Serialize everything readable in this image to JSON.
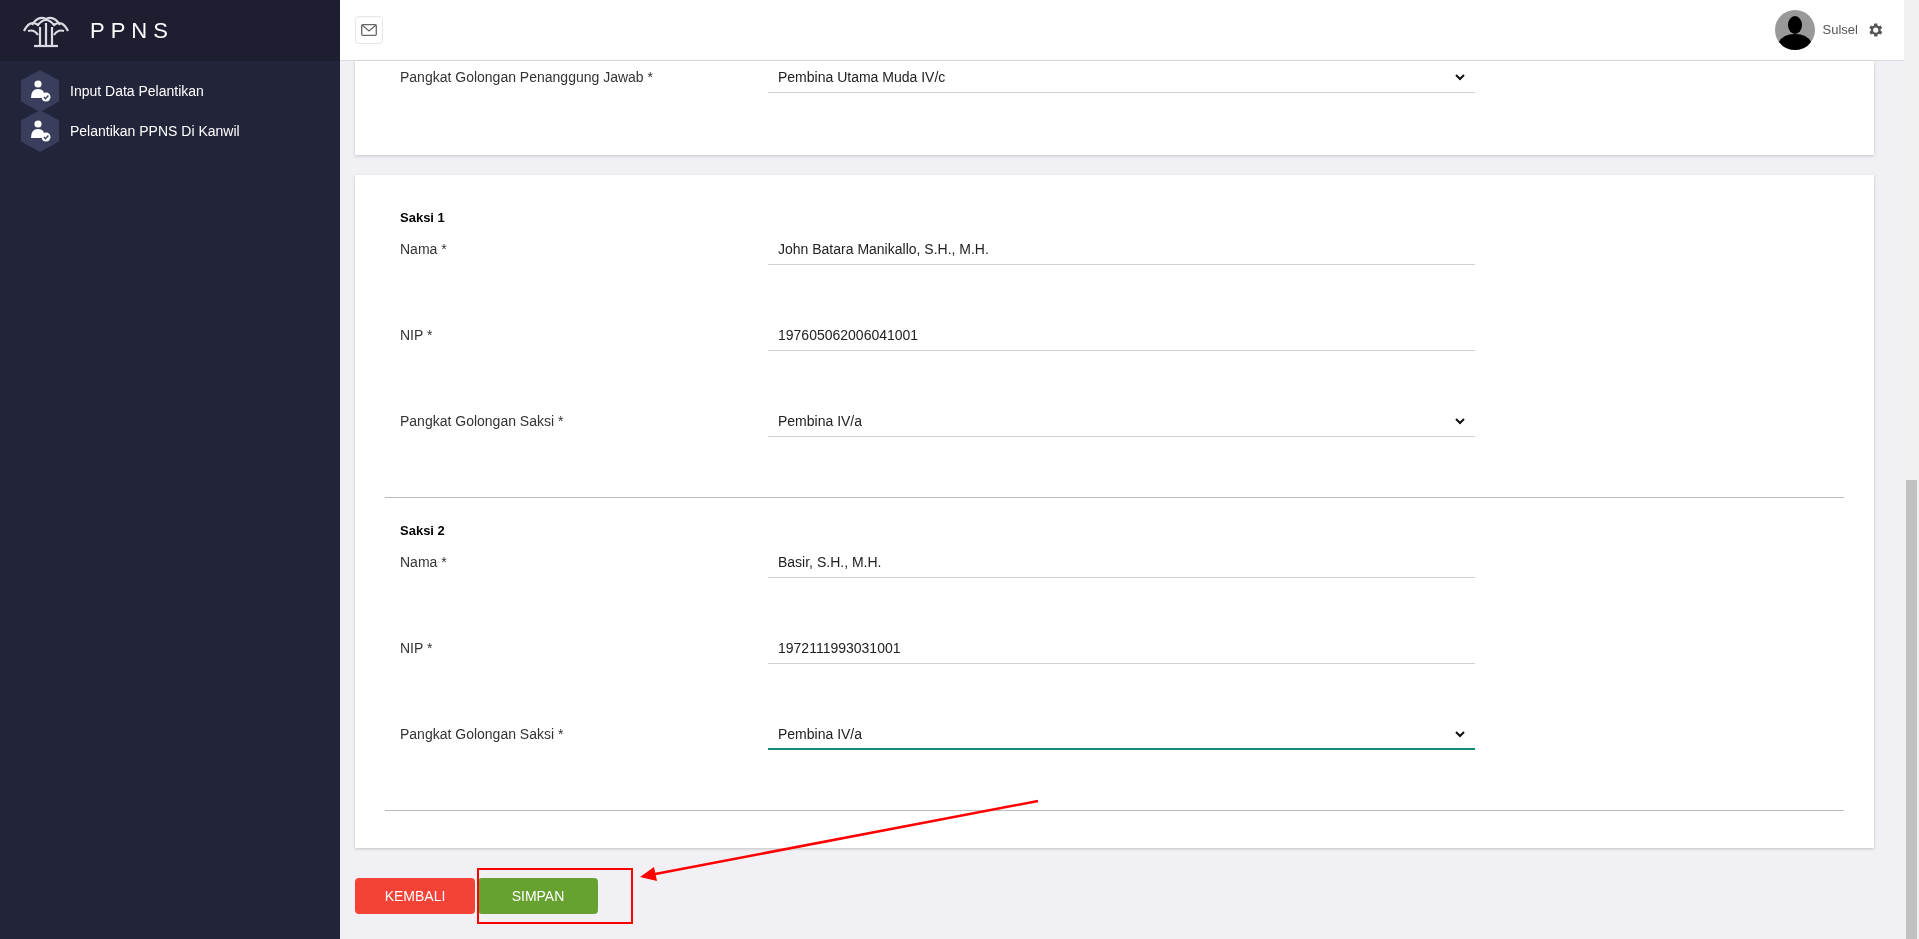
{
  "app": {
    "title": "PPNS"
  },
  "sidebar": {
    "items": [
      {
        "label": "Input Data Pelantikan",
        "selected": false
      },
      {
        "label": "Pelantikan PPNS Di Kanwil",
        "selected": false
      }
    ]
  },
  "topbar": {
    "user": "Sulsel"
  },
  "card_top": {
    "fields": [
      {
        "label": "Pangkat Golongan Penanggung Jawab *",
        "value": "Pembina Utama Muda IV/c",
        "kind": "select",
        "focused": false
      }
    ]
  },
  "sections": [
    {
      "title": "Saksi 1",
      "fields": [
        {
          "label": "Nama *",
          "value": "John Batara Manikallo, S.H., M.H.",
          "kind": "text",
          "focused": false
        },
        {
          "label": "NIP *",
          "value": "197605062006041001",
          "kind": "text",
          "focused": false
        },
        {
          "label": "Pangkat Golongan Saksi *",
          "value": "Pembina IV/a",
          "kind": "select",
          "focused": false
        }
      ]
    },
    {
      "title": "Saksi 2",
      "fields": [
        {
          "label": "Nama *",
          "value": "Basir, S.H., M.H.",
          "kind": "text",
          "focused": false
        },
        {
          "label": "NIP *",
          "value": "1972111993031001",
          "kind": "text",
          "focused": false
        },
        {
          "label": "Pangkat Golongan Saksi *",
          "value": "Pembina IV/a",
          "kind": "select",
          "focused": true
        }
      ]
    }
  ],
  "buttons": [
    {
      "label": "KEMBALI",
      "kind": "back"
    },
    {
      "label": "SIMPAN",
      "kind": "save"
    }
  ],
  "annotation": {
    "highlight": true,
    "arrow": true
  }
}
